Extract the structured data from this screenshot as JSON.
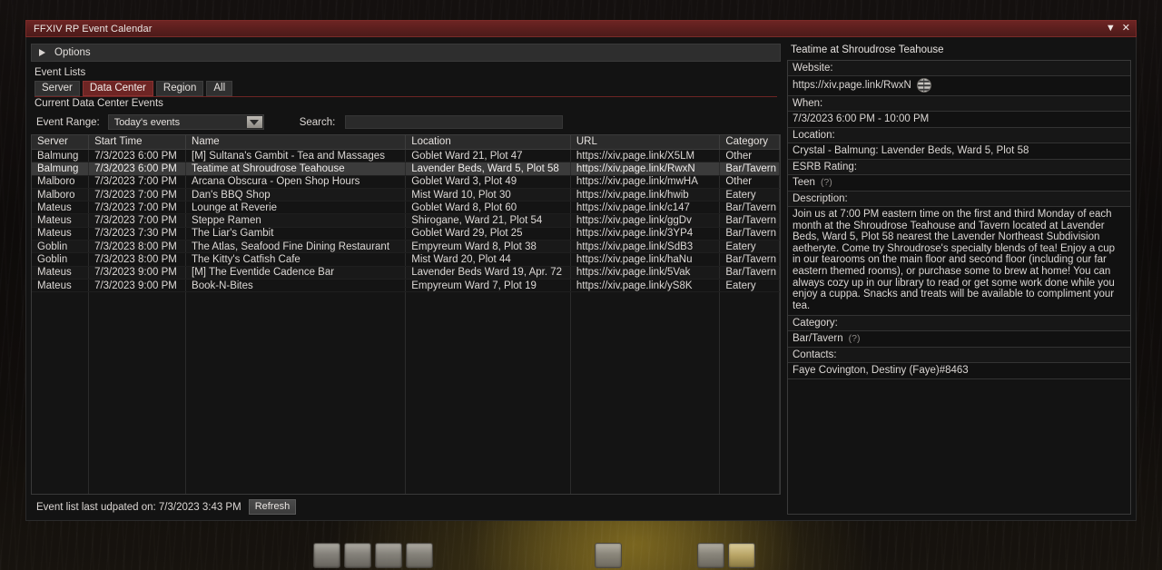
{
  "window": {
    "title": "FFXIV RP Event Calendar",
    "collapse_icon": "triangle-down-icon",
    "close_icon": "close-icon",
    "close_label": "✕",
    "collapse_label": "▼"
  },
  "options": {
    "label": "Options",
    "expander_icon": "triangle-right-icon"
  },
  "event_lists": {
    "label": "Event Lists",
    "tabs": [
      {
        "label": "Server",
        "active": false
      },
      {
        "label": "Data Center",
        "active": true
      },
      {
        "label": "Region",
        "active": false
      },
      {
        "label": "All",
        "active": false
      }
    ]
  },
  "current_list": {
    "heading": "Current Data Center Events",
    "range_label": "Event Range:",
    "range_value": "Today's events",
    "range_options": [
      "Today's events"
    ],
    "search_label": "Search:",
    "search_value": "",
    "search_placeholder": ""
  },
  "table": {
    "columns": [
      "Server",
      "Start Time",
      "Name",
      "Location",
      "URL",
      "Category"
    ],
    "selected_index": 1,
    "rows": [
      {
        "server": "Balmung",
        "start": "7/3/2023 6:00 PM",
        "name": "[M] Sultana's Gambit - Tea and Massages",
        "location": "Goblet Ward 21, Plot 47",
        "url": "https://xiv.page.link/X5LM",
        "category": "Other"
      },
      {
        "server": "Balmung",
        "start": "7/3/2023 6:00 PM",
        "name": "Teatime at Shroudrose Teahouse",
        "location": "Lavender Beds, Ward 5, Plot 58",
        "url": "https://xiv.page.link/RwxN",
        "category": "Bar/Tavern"
      },
      {
        "server": "Malboro",
        "start": "7/3/2023 7:00 PM",
        "name": "Arcana Obscura - Open Shop Hours",
        "location": "Goblet Ward 3, Plot 49",
        "url": "https://xiv.page.link/mwHA",
        "category": "Other"
      },
      {
        "server": "Malboro",
        "start": "7/3/2023 7:00 PM",
        "name": "Dan's BBQ Shop",
        "location": "Mist Ward 10, Plot 30",
        "url": "https://xiv.page.link/hwib",
        "category": "Eatery"
      },
      {
        "server": "Mateus",
        "start": "7/3/2023 7:00 PM",
        "name": "Lounge at Reverie",
        "location": "Goblet Ward 8, Plot 60",
        "url": "https://xiv.page.link/c147",
        "category": "Bar/Tavern"
      },
      {
        "server": "Mateus",
        "start": "7/3/2023 7:00 PM",
        "name": "Steppe Ramen",
        "location": "Shirogane, Ward 21, Plot 54",
        "url": "https://xiv.page.link/ggDv",
        "category": "Bar/Tavern"
      },
      {
        "server": "Mateus",
        "start": "7/3/2023 7:30 PM",
        "name": "The Liar's Gambit",
        "location": "Goblet Ward 29, Plot 25",
        "url": "https://xiv.page.link/3YP4",
        "category": "Bar/Tavern"
      },
      {
        "server": "Goblin",
        "start": "7/3/2023 8:00 PM",
        "name": "The Atlas, Seafood Fine Dining Restaurant",
        "location": "Empyreum Ward 8, Plot 38",
        "url": "https://xiv.page.link/SdB3",
        "category": "Eatery"
      },
      {
        "server": "Goblin",
        "start": "7/3/2023 8:00 PM",
        "name": "The Kitty's Catfish Cafe",
        "location": "Mist Ward 20, Plot 44",
        "url": "https://xiv.page.link/haNu",
        "category": "Bar/Tavern"
      },
      {
        "server": "Mateus",
        "start": "7/3/2023 9:00 PM",
        "name": "[M] The Eventide Cadence Bar",
        "location": "Lavender Beds Ward 19, Apr. 72",
        "url": "https://xiv.page.link/5Vak",
        "category": "Bar/Tavern"
      },
      {
        "server": "Mateus",
        "start": "7/3/2023 9:00 PM",
        "name": "Book-N-Bites",
        "location": "Empyreum Ward 7, Plot 19",
        "url": "https://xiv.page.link/yS8K",
        "category": "Eatery"
      }
    ]
  },
  "footer": {
    "status": "Event list last udpated on: 7/3/2023 3:43 PM",
    "refresh_label": "Refresh"
  },
  "detail": {
    "title": "Teatime at Shroudrose Teahouse",
    "website_label": "Website:",
    "website_value": "https://xiv.page.link/RwxN",
    "website_icon": "globe-icon",
    "when_label": "When:",
    "when_value": "7/3/2023 6:00 PM - 10:00 PM",
    "location_label": "Location:",
    "location_value": "Crystal - Balmung: Lavender Beds, Ward 5, Plot 58",
    "esrb_label": "ESRB Rating:",
    "esrb_value": "Teen",
    "esrb_hint": "(?)",
    "description_label": "Description:",
    "description_value": "Join us at 7:00 PM eastern time on the first and third Monday of each month at the Shroudrose Teahouse and Tavern located at Lavender Beds, Ward 5, Plot 58 nearest the Lavender Northeast Subdivision aetheryte. Come try Shroudrose's specialty blends of tea! Enjoy a cup in our tearooms on the main floor and second floor (including our far eastern themed rooms), or purchase some to brew at home! You can always cozy up in our library to read or get some work done while you enjoy a cuppa. Snacks and treats will be available to compliment your tea.",
    "category_label": "Category:",
    "category_value": "Bar/Tavern",
    "category_hint": "(?)",
    "contacts_label": "Contacts:",
    "contacts_value": "Faye Covington, Destiny (Faye)#8463"
  },
  "colors": {
    "accent": "#6e2524",
    "window_bg": "#131313",
    "selected_row": "#3b3b3b"
  }
}
